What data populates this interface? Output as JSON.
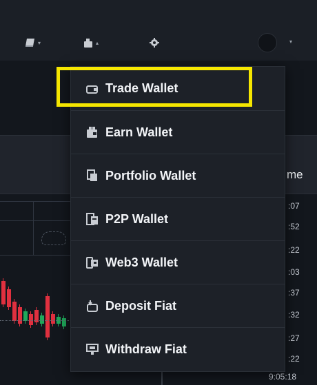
{
  "toolbar": {
    "icons": [
      "book-icon",
      "wallet-icon",
      "settings-icon"
    ],
    "caret": "▾",
    "caret_up": "▴"
  },
  "wallet_menu": {
    "items": [
      {
        "label": "Trade Wallet",
        "icon": "trade-wallet-icon"
      },
      {
        "label": "Earn Wallet",
        "icon": "earn-wallet-icon"
      },
      {
        "label": "Portfolio Wallet",
        "icon": "portfolio-wallet-icon"
      },
      {
        "label": "P2P Wallet",
        "icon": "p2p-wallet-icon"
      },
      {
        "label": "Web3 Wallet",
        "icon": "web3-wallet-icon"
      },
      {
        "label": "Deposit Fiat",
        "icon": "deposit-fiat-icon"
      },
      {
        "label": "Withdraw Fiat",
        "icon": "withdraw-fiat-icon"
      }
    ],
    "highlight_color": "#f5e600"
  },
  "background": {
    "time_header": "me",
    "times": [
      ":07",
      ":52",
      ":22",
      ":03",
      ":37",
      ":32",
      ":27",
      ":22"
    ],
    "last_time": "9:05:18",
    "colors": {
      "up": "#1fa85a",
      "down": "#e0303f"
    }
  }
}
